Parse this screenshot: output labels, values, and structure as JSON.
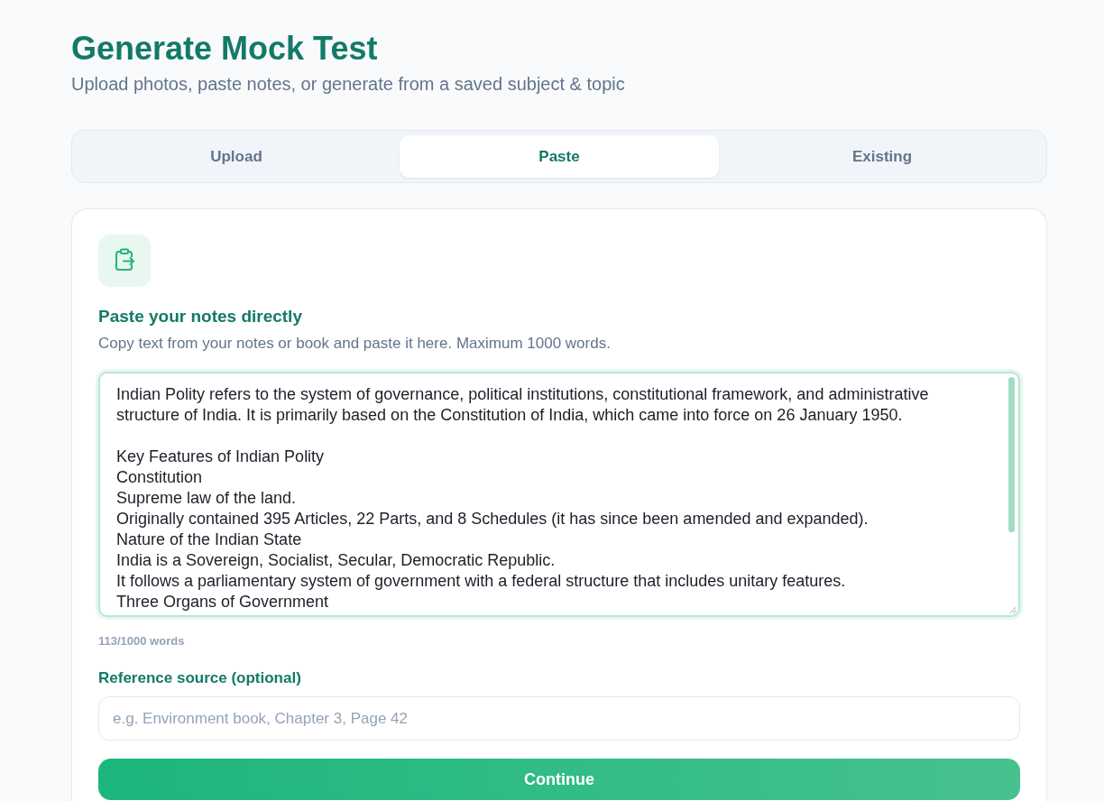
{
  "header": {
    "title": "Generate Mock Test",
    "subtitle": "Upload photos, paste notes, or generate from a saved subject & topic"
  },
  "tabs": [
    {
      "label": "Upload",
      "selected": false
    },
    {
      "label": "Paste",
      "selected": true
    },
    {
      "label": "Existing",
      "selected": false
    }
  ],
  "paste_panel": {
    "title": "Paste your notes directly",
    "description": "Copy text from your notes or book and paste it here. Maximum 1000 words.",
    "notes": {
      "value": "Indian Polity refers to the system of governance, political institutions, constitutional framework, and administrative structure of India. It is primarily based on the Constitution of India, which came into force on 26 January 1950.\n\nKey Features of Indian Polity\nConstitution\nSupreme law of the land.\nOriginally contained 395 Articles, 22 Parts, and 8 Schedules (it has since been amended and expanded).\nNature of the Indian State\nIndia is a Sovereign, Socialist, Secular, Democratic Republic.\nIt follows a parliamentary system of government with a federal structure that includes unitary features.\nThree Organs of Government"
    },
    "word_count": "113/1000 words",
    "reference": {
      "label": "Reference source (optional)",
      "placeholder": "e.g. Environment book, Chapter 3, Page 42"
    },
    "continue_button": "Continue"
  }
}
